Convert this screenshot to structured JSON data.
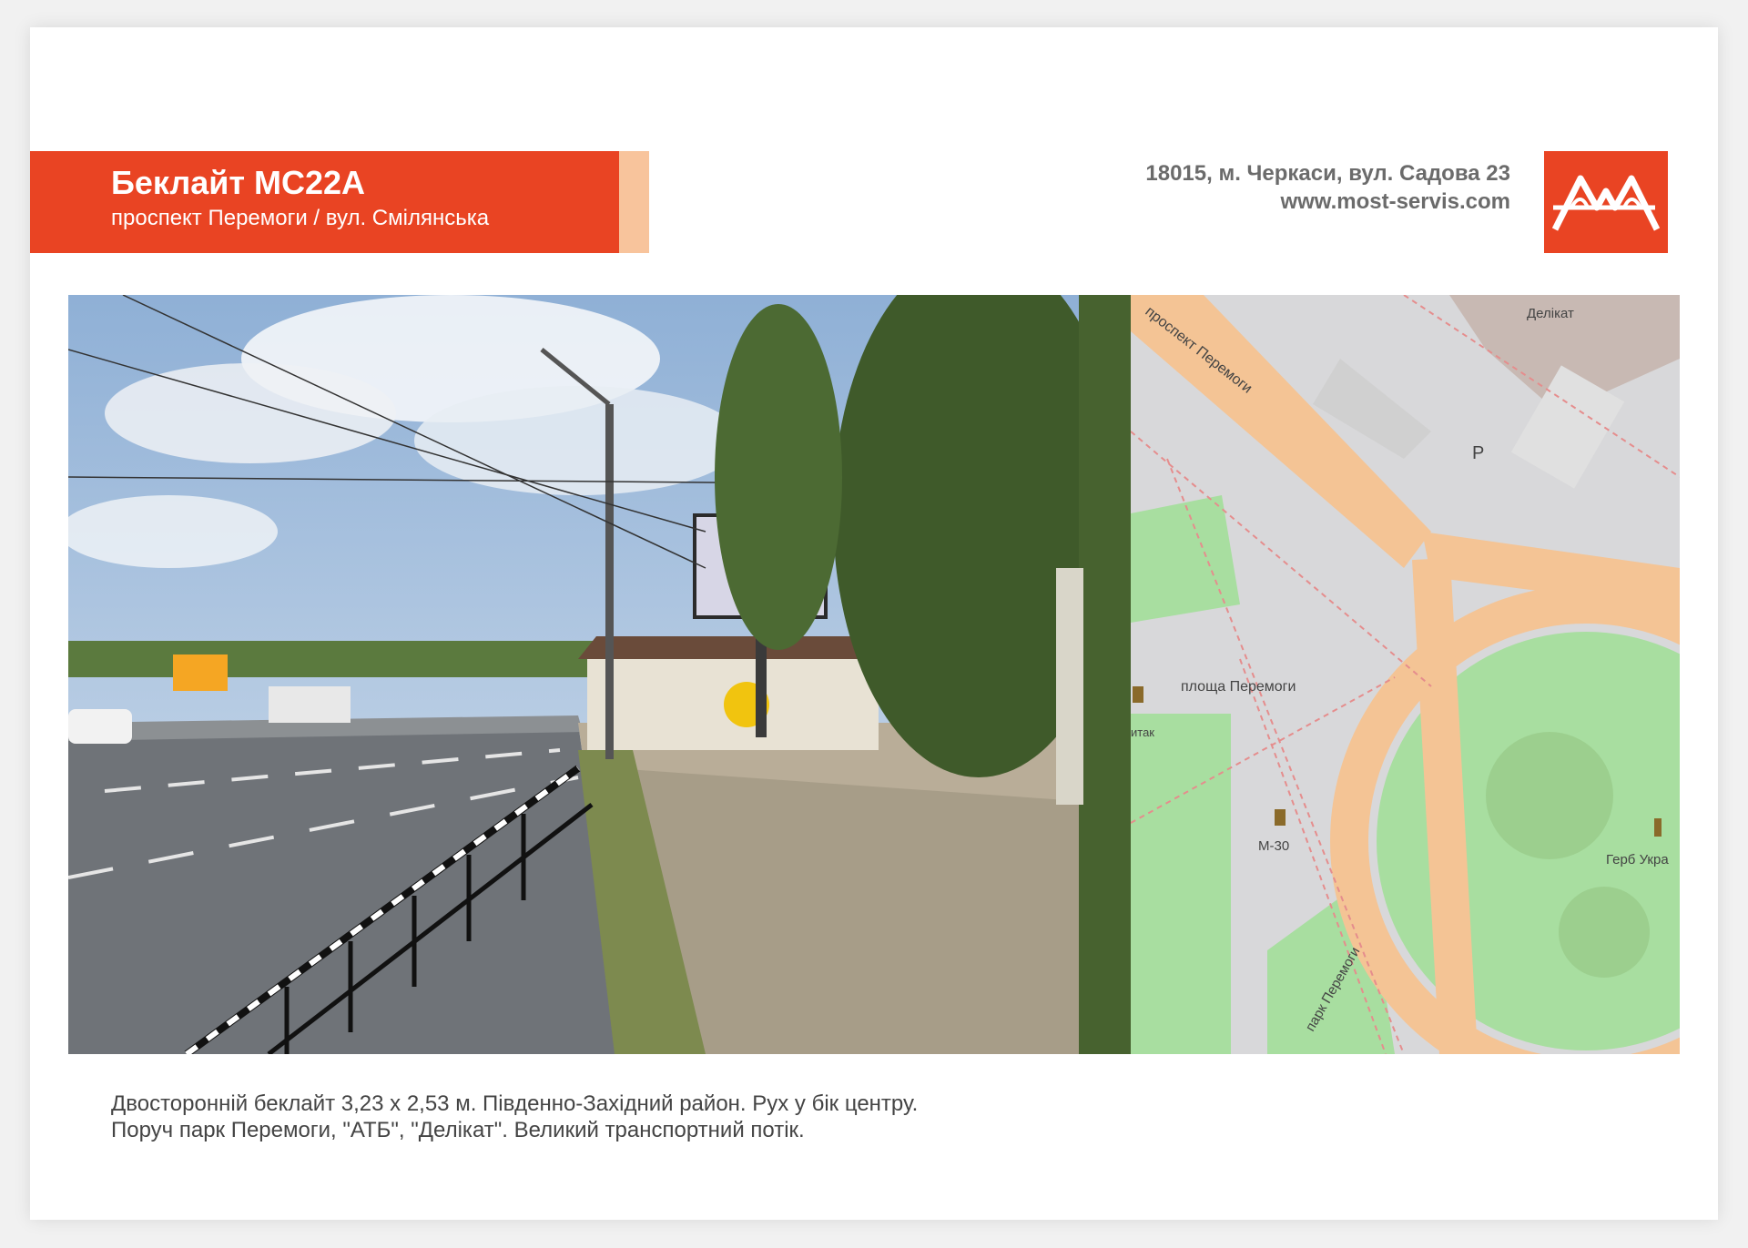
{
  "header": {
    "title": "Беклайт МС22А",
    "subtitle": "проспект Перемоги / вул. Смілянська",
    "address": "18015, м. Черкаси, вул. Садова 23",
    "website": "www.most-servis.com"
  },
  "colors": {
    "brand": "#e94423",
    "tab": "#f8c49c",
    "text_gray": "#6b6b6b"
  },
  "logo": {
    "icon": "bridge-logo-icon"
  },
  "photo": {
    "description_icon": "street-photo"
  },
  "map": {
    "labels": {
      "avenue": "проспект Перемоги",
      "store": "Делікат",
      "square": "площа Перемоги",
      "monument": "М-30",
      "emblem": "Герб Укра",
      "park": "парк Перемоги",
      "tak": "итак",
      "parking": "P"
    }
  },
  "description": {
    "line1": "Двосторонній беклайт 3,23 х 2,53 м. Південно-Західний район. Рух у бік центру.",
    "line2": "Поруч парк Перемоги, \"АТБ\", \"Делікат\". Великий транспортний потік."
  }
}
